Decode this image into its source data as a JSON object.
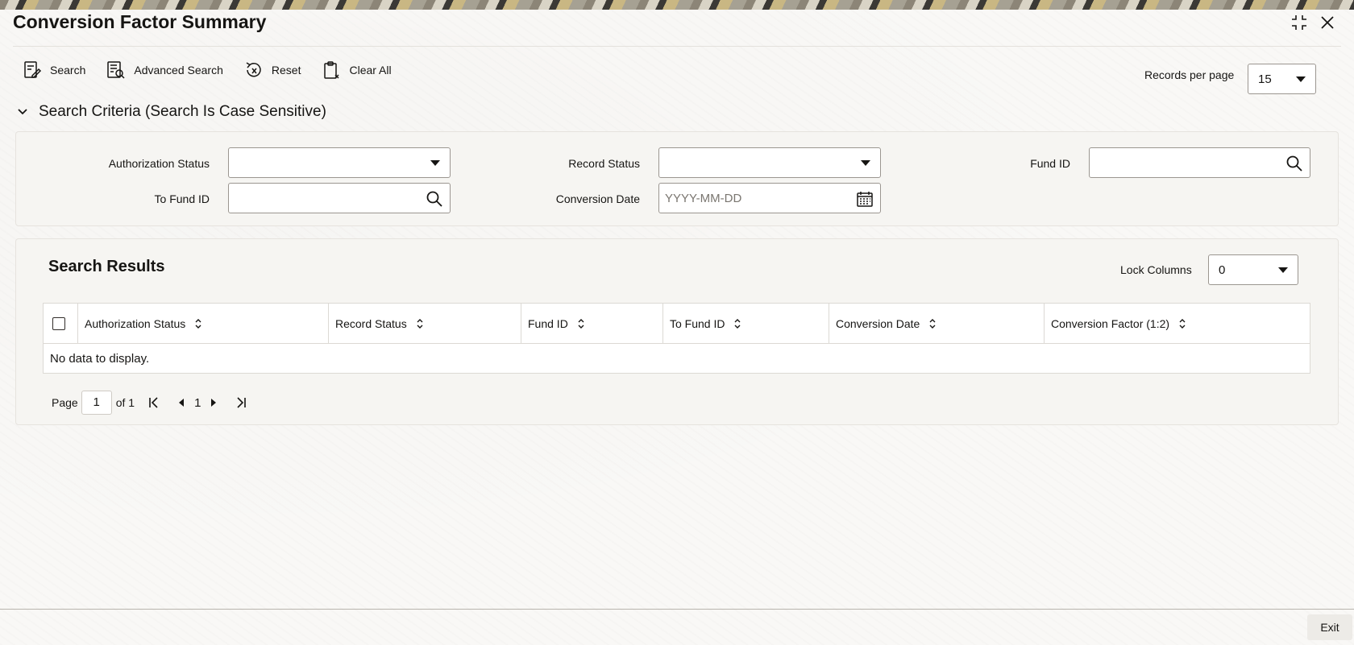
{
  "window": {
    "title": "Conversion Factor Summary",
    "controls": [
      "maximize-icon",
      "close-icon"
    ]
  },
  "toolbar": {
    "search_label": "Search",
    "advanced_search_label": "Advanced Search",
    "reset_label": "Reset",
    "clear_all_label": "Clear All"
  },
  "records_per_page": {
    "label": "Records per page",
    "value": "15"
  },
  "search_criteria": {
    "heading": "Search Criteria (Search Is Case Sensitive)",
    "fields": {
      "authorization_status": {
        "label": "Authorization Status",
        "value": ""
      },
      "record_status": {
        "label": "Record Status",
        "value": ""
      },
      "fund_id": {
        "label": "Fund ID",
        "value": ""
      },
      "to_fund_id": {
        "label": "To Fund ID",
        "value": ""
      },
      "conversion_date": {
        "label": "Conversion Date",
        "value": "",
        "placeholder": "YYYY-MM-DD"
      }
    }
  },
  "results": {
    "title": "Search Results",
    "lock_columns": {
      "label": "Lock Columns",
      "value": "0"
    },
    "columns": [
      "Authorization Status",
      "Record Status",
      "Fund ID",
      "To Fund ID",
      "Conversion Date",
      "Conversion Factor (1:2)"
    ],
    "rows": [],
    "empty_message": "No data to display."
  },
  "pagination": {
    "page_label": "Page",
    "current_page": "1",
    "of_label": "of 1",
    "page_number": "1"
  },
  "footer": {
    "exit_label": "Exit"
  },
  "colors": {
    "text": "#161513",
    "border": "#9b9690",
    "panel": "#f6f5f2",
    "background": "#f9f8f6"
  }
}
